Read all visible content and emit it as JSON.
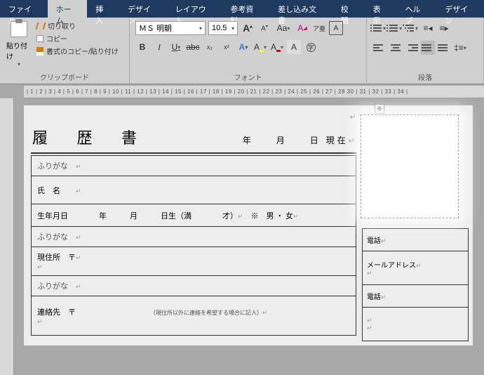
{
  "tabs": {
    "file": "ファイル",
    "home": "ホーム",
    "insert": "挿入",
    "design": "デザイン",
    "layout": "レイアウト",
    "references": "参考資料",
    "mailmerge": "差し込み文書",
    "review": "校閲",
    "view": "表示",
    "help": "ヘルプ",
    "design2": "デザイン"
  },
  "ribbon": {
    "clipboard": {
      "paste": "貼り付け",
      "cut": "切り取り",
      "copy": "コピー",
      "format_painter": "書式のコピー/貼り付け",
      "label": "クリップボード"
    },
    "font": {
      "name": "ＭＳ 明朝",
      "size": "10.5",
      "label": "フォント",
      "ruby": "ア亜",
      "clear": "A",
      "enclose": "囲"
    },
    "paragraph": {
      "label": "段落"
    }
  },
  "ruler_text": "| 1 | 2 | 3 | 4 | 5 | 6 | 7 | 8 | 9 | 10 | 11 | 12 | 13 | 14 | 15 | 16 | 17 | 18 | 19 | 20 | 21 | 22 | 23 | 24 | 25 | 26 | 27 | 28        30 | 31 | 32 | 33 | 34 |",
  "doc": {
    "title": "履 歴 書",
    "date_line": "年　　月　　日 現在",
    "furigana": "ふりがな",
    "name_label": "氏　名",
    "birth_line": "生年月日　　　　年　　　月　　　日生（満　　　　才）",
    "gender": "※　男 ・ 女",
    "address_label": "現住所　〒",
    "contact_label": "連絡先　〒",
    "contact_note": "（現住所以外に連絡を希望する場合に記入）",
    "phone": "電話",
    "email": "メールアドレス"
  }
}
